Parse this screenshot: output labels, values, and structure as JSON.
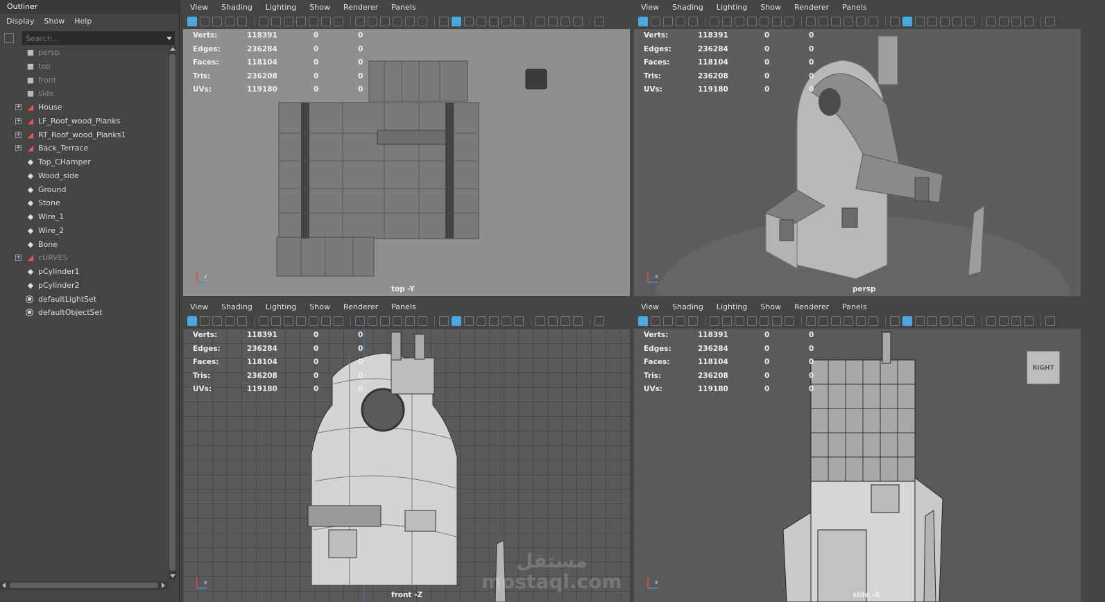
{
  "outliner": {
    "title": "Outliner",
    "menu": [
      "Display",
      "Show",
      "Help"
    ],
    "search_placeholder": "Search...",
    "items": [
      {
        "label": "persp",
        "icon": "camera-icon",
        "dim": true,
        "expandable": false
      },
      {
        "label": "top",
        "icon": "camera-icon",
        "dim": true,
        "expandable": false
      },
      {
        "label": "front",
        "icon": "camera-icon",
        "dim": true,
        "expandable": false
      },
      {
        "label": "side",
        "icon": "camera-icon",
        "dim": true,
        "expandable": false
      },
      {
        "label": "House",
        "icon": "group-icon",
        "dim": false,
        "expandable": true
      },
      {
        "label": "LF_Roof_wood_Planks",
        "icon": "group-icon",
        "dim": false,
        "expandable": true
      },
      {
        "label": "RT_Roof_wood_Planks1",
        "icon": "group-icon",
        "dim": false,
        "expandable": true
      },
      {
        "label": "Back_Terrace",
        "icon": "group-icon",
        "dim": false,
        "expandable": true
      },
      {
        "label": "Top_CHamper",
        "icon": "mesh-icon",
        "dim": false,
        "expandable": false
      },
      {
        "label": "Wood_side",
        "icon": "mesh-icon",
        "dim": false,
        "expandable": false
      },
      {
        "label": "Ground",
        "icon": "mesh-icon",
        "dim": false,
        "expandable": false
      },
      {
        "label": "Stone",
        "icon": "mesh-icon",
        "dim": false,
        "expandable": false
      },
      {
        "label": "Wire_1",
        "icon": "mesh-icon",
        "dim": false,
        "expandable": false
      },
      {
        "label": "Wire_2",
        "icon": "mesh-icon",
        "dim": false,
        "expandable": false
      },
      {
        "label": "Bone",
        "icon": "mesh-icon",
        "dim": false,
        "expandable": false
      },
      {
        "label": "cURVES",
        "icon": "group-icon",
        "dim": true,
        "expandable": true
      },
      {
        "label": "pCylinder1",
        "icon": "mesh-icon",
        "dim": false,
        "expandable": false
      },
      {
        "label": "pCylinder2",
        "icon": "mesh-icon",
        "dim": false,
        "expandable": false
      },
      {
        "label": "defaultLightSet",
        "icon": "set-icon",
        "dim": false,
        "expandable": false
      },
      {
        "label": "defaultObjectSet",
        "icon": "set-icon",
        "dim": false,
        "expandable": false
      }
    ]
  },
  "panel_menu": [
    "View",
    "Shading",
    "Lighting",
    "Show",
    "Renderer",
    "Panels"
  ],
  "hud": [
    {
      "label": "Verts:",
      "v1": "118391",
      "v2": "0",
      "v3": "0"
    },
    {
      "label": "Edges:",
      "v1": "236284",
      "v2": "0",
      "v3": "0"
    },
    {
      "label": "Faces:",
      "v1": "118104",
      "v2": "0",
      "v3": "0"
    },
    {
      "label": "Tris:",
      "v1": "236208",
      "v2": "0",
      "v3": "0"
    },
    {
      "label": "UVs:",
      "v1": "119180",
      "v2": "0",
      "v3": "0"
    }
  ],
  "viewports": [
    {
      "id": "top",
      "label": "top -Y",
      "background": "#8f8f8f"
    },
    {
      "id": "persp",
      "label": "persp",
      "background": "#5d5d5d"
    },
    {
      "id": "front",
      "label": "front -Z",
      "background": "#5a5a5a"
    },
    {
      "id": "side",
      "label": "side -X",
      "background": "#5a5a5a"
    }
  ],
  "viewcube_label": "RIGHT",
  "watermark": {
    "line1": "مستقل",
    "line2": "mostaql.com"
  },
  "colors": {
    "accent": "#4aa8e0",
    "group_icon": "#e55555"
  }
}
